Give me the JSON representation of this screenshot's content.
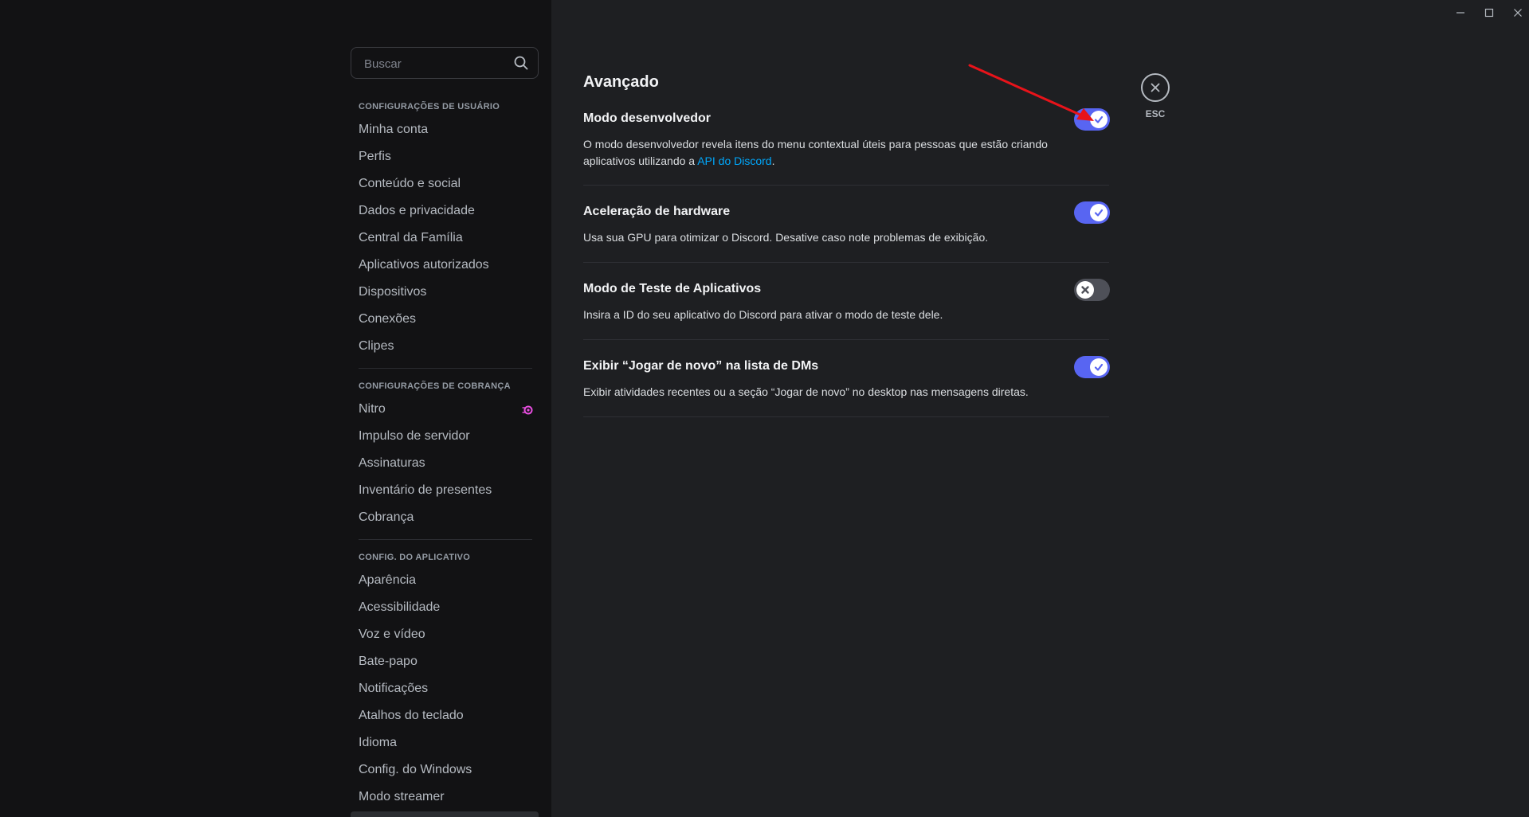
{
  "search": {
    "placeholder": "Buscar"
  },
  "sidebar": {
    "user_settings_header": "Configurações de usuário",
    "user_settings": [
      "Minha conta",
      "Perfis",
      "Conteúdo e social",
      "Dados e privacidade",
      "Central da Família",
      "Aplicativos autorizados",
      "Dispositivos",
      "Conexões",
      "Clipes"
    ],
    "billing_header": "Configurações de cobrança",
    "billing": [
      "Nitro",
      "Impulso de servidor",
      "Assinaturas",
      "Inventário de presentes",
      "Cobrança"
    ],
    "app_header": "Config. do aplicativo",
    "app": [
      "Aparência",
      "Acessibilidade",
      "Voz e vídeo",
      "Bate-papo",
      "Notificações",
      "Atalhos do teclado",
      "Idioma",
      "Config. do Windows",
      "Modo streamer"
    ]
  },
  "main": {
    "title": "Avançado",
    "settings": [
      {
        "title": "Modo desenvolvedor",
        "desc_before": "O modo desenvolvedor revela itens do menu contextual úteis para pessoas que estão criando aplicativos utilizando a ",
        "desc_link": "API do Discord",
        "desc_after": ".",
        "enabled": true
      },
      {
        "title": "Aceleração de hardware",
        "desc": "Usa sua GPU para otimizar o Discord. Desative caso note problemas de exibição.",
        "enabled": true
      },
      {
        "title": "Modo de Teste de Aplicativos",
        "desc": "Insira a ID do seu aplicativo do Discord para ativar o modo de teste dele.",
        "enabled": false
      },
      {
        "title": "Exibir “Jogar de novo” na lista de DMs",
        "desc": "Exibir atividades recentes ou a seção “Jogar de novo” no desktop nas mensagens diretas.",
        "enabled": true
      }
    ]
  },
  "close": {
    "label": "ESC"
  },
  "colors": {
    "accent": "#5865f2",
    "toggle_off": "#4e5058",
    "link": "#00a8fc",
    "annotation": "#e8131a",
    "nitro": "#e84ee0"
  },
  "icons": {
    "search": "search-icon",
    "close": "close-icon",
    "check": "check-icon",
    "x": "x-icon",
    "nitro": "nitro-icon"
  }
}
